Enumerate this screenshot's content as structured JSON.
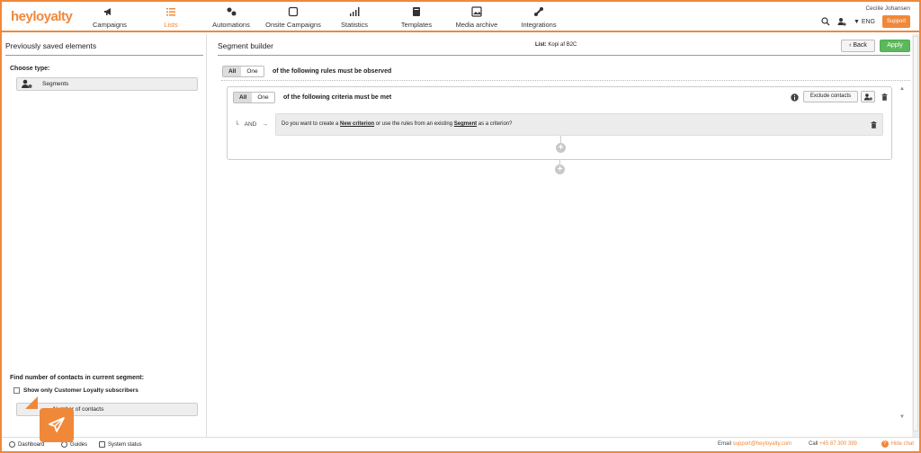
{
  "brand": {
    "logo_text": "heyloyalty",
    "accent": "#f0883a",
    "apply_color": "#5cb85c"
  },
  "nav": [
    {
      "label": "Campaigns",
      "icon": "megaphone-icon"
    },
    {
      "label": "Lists",
      "icon": "list-icon",
      "active": true
    },
    {
      "label": "Automations",
      "icon": "automations-icon"
    },
    {
      "label": "Onsite Campaigns",
      "icon": "onsite-icon"
    },
    {
      "label": "Statistics",
      "icon": "statistics-icon"
    },
    {
      "label": "Templates",
      "icon": "templates-icon"
    },
    {
      "label": "Media archive",
      "icon": "media-archive-icon"
    },
    {
      "label": "Integrations",
      "icon": "integrations-icon"
    }
  ],
  "user": {
    "name": "Cecilie Johansen",
    "language": "ENG",
    "support_label": "Support"
  },
  "left": {
    "title": "Previously saved elements",
    "choose_type": "Choose type:",
    "segments_label": "Segments",
    "find_title": "Find number of contacts in current segment:",
    "checkbox_label": "Show only Customer Loyalty subscribers",
    "count_label": "Number of contacts"
  },
  "main": {
    "title": "Segment builder",
    "list_prefix": "List:",
    "list_name": "Kopi af B2C",
    "back_label": "Back",
    "apply_label": "Apply",
    "rules": {
      "all": "All",
      "one": "One",
      "text": "of the following rules must be observed"
    },
    "criteria": {
      "all": "All",
      "one": "One",
      "text": "of the following criteria must be met"
    },
    "exclude_label": "Exclude contacts",
    "and_label": "AND",
    "question": {
      "before": "Do you want to create a ",
      "link1": "New criterion",
      "middle": " or use the rules from an existing ",
      "link2": "Segment",
      "after": " as a criterion?"
    }
  },
  "footer": {
    "dashboard": "Dashboard",
    "guides": "Guides",
    "system_status": "System status",
    "email_label": "Email",
    "email": "support@heyloyalty.com",
    "call_label": "Call",
    "phone": "+45 87 300 399",
    "hide_chat": "Hide chat"
  }
}
